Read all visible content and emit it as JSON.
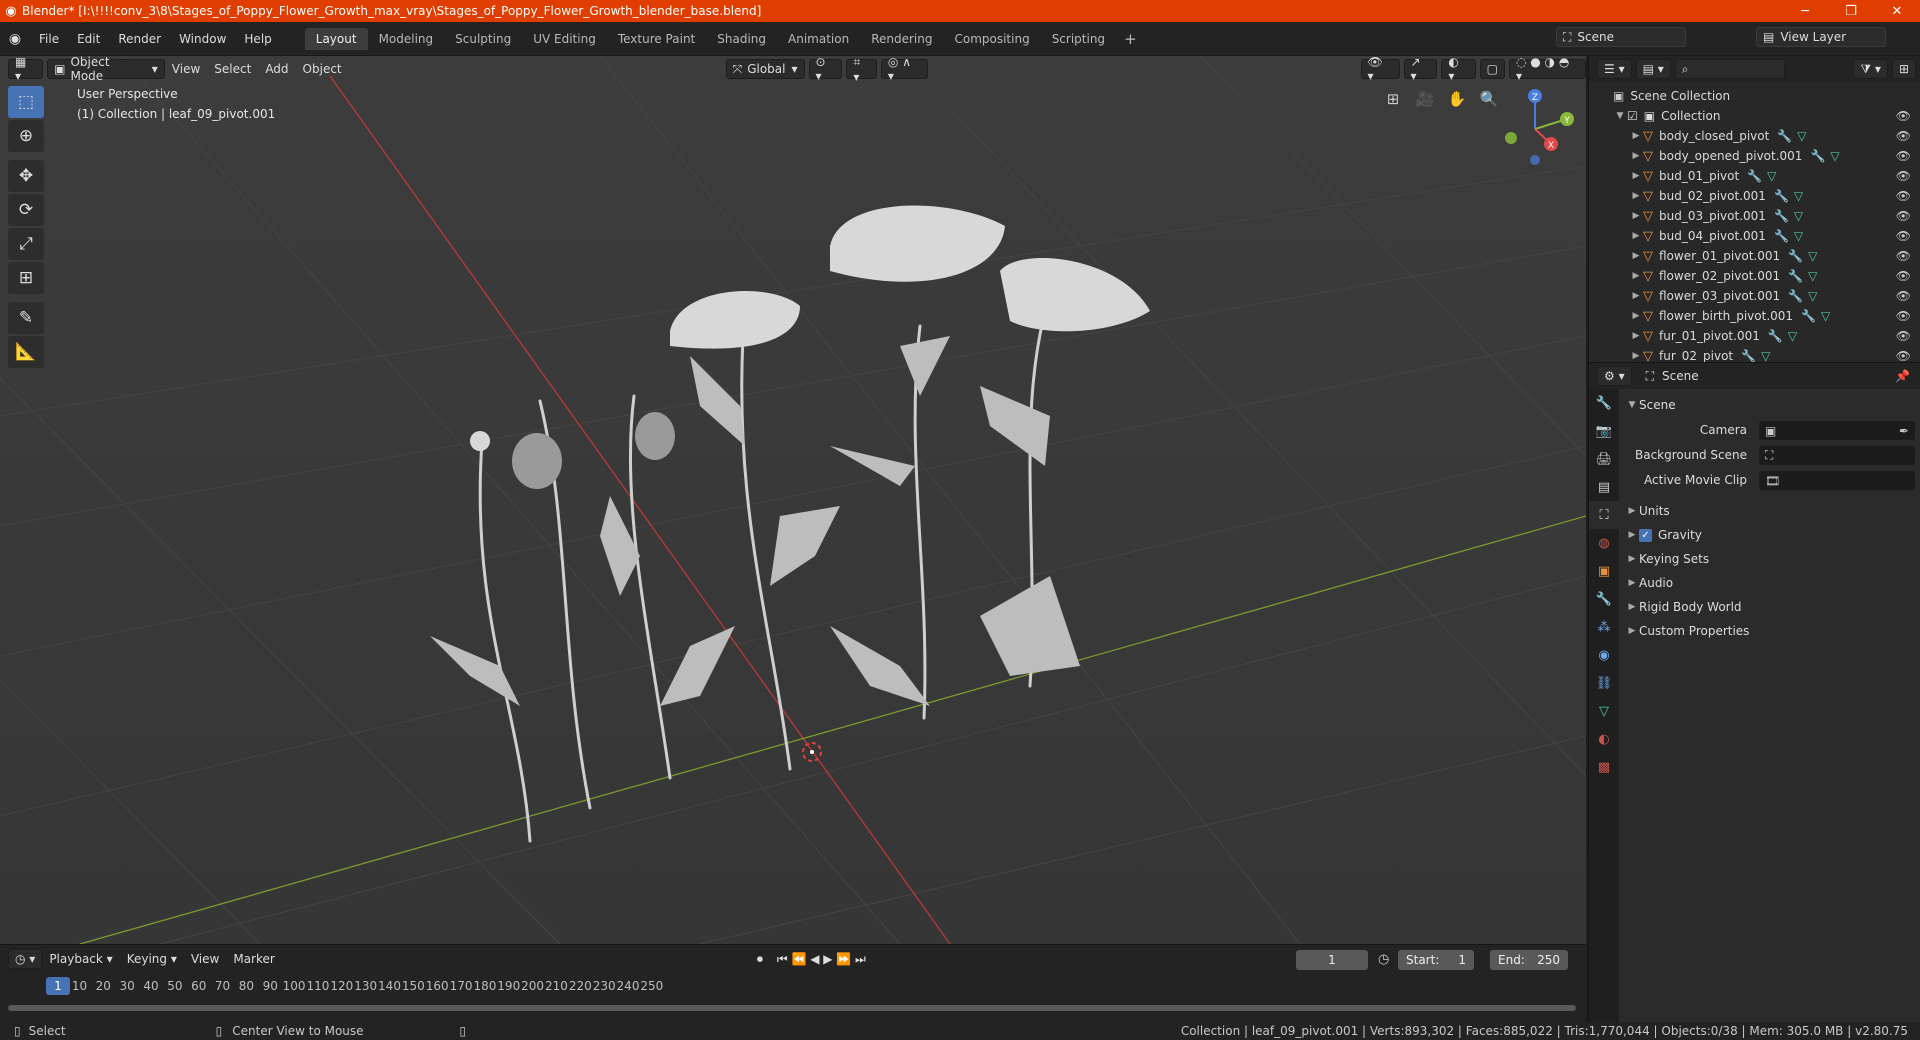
{
  "window": {
    "title": "Blender* [I:\\!!!!conv_3\\8\\Stages_of_Poppy_Flower_Growth_max_vray\\Stages_of_Poppy_Flower_Growth_blender_base.blend]",
    "minimize": "─",
    "maximize": "❐",
    "close": "✕"
  },
  "menubar": {
    "items": [
      "File",
      "Edit",
      "Render",
      "Window",
      "Help"
    ]
  },
  "workspaces": {
    "tabs": [
      "Layout",
      "Modeling",
      "Sculpting",
      "UV Editing",
      "Texture Paint",
      "Shading",
      "Animation",
      "Rendering",
      "Compositing",
      "Scripting"
    ],
    "active": "Layout",
    "add": "+"
  },
  "scene_selector": {
    "value": "Scene"
  },
  "view_layer_selector": {
    "value": "View Layer"
  },
  "viewport": {
    "mode": "Object Mode",
    "menus": [
      "View",
      "Select",
      "Add",
      "Object"
    ],
    "transform_orientation": "Global",
    "info_line1": "User Perspective",
    "info_line2": "(1) Collection | leaf_09_pivot.001",
    "gizmo_axes": {
      "x": "X",
      "y": "Y",
      "z": "Z"
    }
  },
  "outliner": {
    "root": "Scene Collection",
    "collection": "Collection",
    "objects": [
      "body_closed_pivot",
      "body_opened_pivot.001",
      "bud_01_pivot",
      "bud_02_pivot.001",
      "bud_03_pivot.001",
      "bud_04_pivot.001",
      "flower_01_pivot.001",
      "flower_02_pivot.001",
      "flower_03_pivot.001",
      "flower_birth_pivot.001",
      "fur_01_pivot.001",
      "fur_02_pivot"
    ]
  },
  "properties": {
    "header": "Scene",
    "panel_title": "Scene",
    "fields": {
      "camera_label": "Camera",
      "background_scene_label": "Background Scene",
      "active_movie_clip_label": "Active Movie Clip"
    },
    "subpanels": [
      "Units",
      "Gravity",
      "Keying Sets",
      "Audio",
      "Rigid Body World",
      "Custom Properties"
    ]
  },
  "timeline": {
    "menus": [
      "Playback",
      "Keying",
      "View",
      "Marker"
    ],
    "current_frame": "1",
    "start_label": "Start:",
    "start": "1",
    "end_label": "End:",
    "end": "250",
    "ruler": [
      "10",
      "20",
      "30",
      "40",
      "50",
      "60",
      "70",
      "80",
      "90",
      "100",
      "110",
      "120",
      "130",
      "140",
      "150",
      "160",
      "170",
      "180",
      "190",
      "200",
      "210",
      "220",
      "230",
      "240",
      "250"
    ]
  },
  "statusbar": {
    "select": "Select",
    "center_view": "Center View to Mouse",
    "stats": "Collection | leaf_09_pivot.001 | Verts:893,302 | Faces:885,022 | Tris:1,770,044 | Objects:0/38 | Mem: 305.0 MB | v2.80.75"
  },
  "colors": {
    "title_bar": "#e03e00",
    "accent": "#4772b3",
    "x_axis": "#b83a3a",
    "y_axis": "#7a9a2e",
    "object_icon": "#e8903c"
  }
}
